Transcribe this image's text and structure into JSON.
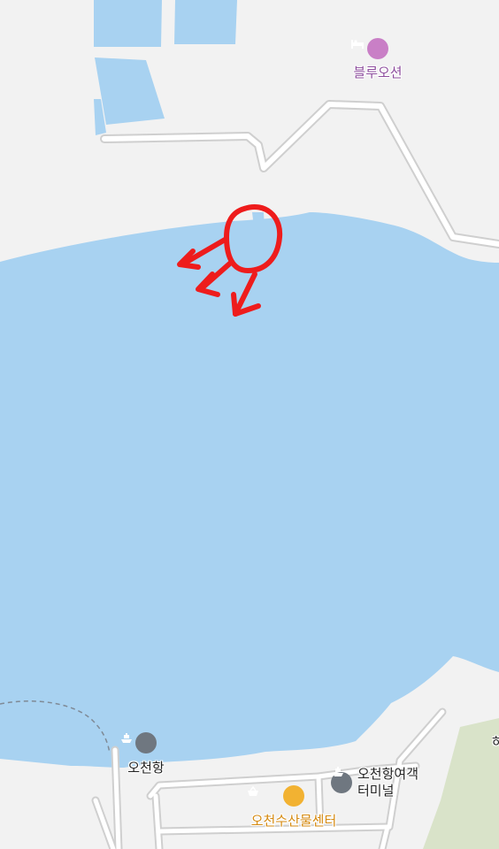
{
  "map": {
    "colors": {
      "land": "#f2f2f2",
      "water": "#a8d2f1",
      "road_fill": "#ffffff",
      "road_casing": "#cfcfcf",
      "park": "#d9e3c9",
      "hotel_icon": "#c97fc6",
      "hotel_label": "#8d4e9d",
      "port_icon": "#6f7780",
      "port_label": "#222222",
      "market_icon": "#f2b232",
      "market_label": "#d58a10",
      "annotation": "#ee1c1c",
      "ferry_route": "#7f8a96"
    },
    "pois": [
      {
        "label": "블루오션",
        "icon": "bed-icon",
        "category": "lodging"
      },
      {
        "label": "오천항",
        "icon": "ship-icon",
        "category": "port"
      },
      {
        "label": "오천항여객\n터미널",
        "icon": "ship-icon",
        "category": "ferry-terminal"
      },
      {
        "label": "오천수산물센터",
        "icon": "basket-icon",
        "category": "market"
      },
      {
        "label": "하",
        "icon": "",
        "category": "clipped-label"
      }
    ],
    "annotation": {
      "description": "hand-drawn red circle with three arrows",
      "color": "#ee1c1c"
    }
  }
}
